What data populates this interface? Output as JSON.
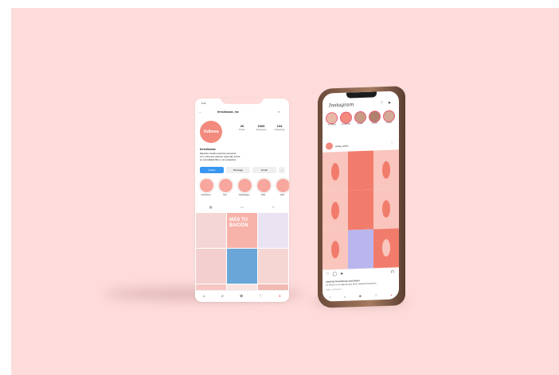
{
  "left_phone": {
    "status_time": "9:41",
    "username": "fervulbosas_mx",
    "avatar_text": "Vulbosa",
    "stats": [
      {
        "n": "26",
        "l": "Posts"
      },
      {
        "n": "1666",
        "l": "Followers"
      },
      {
        "n": "134",
        "l": "Following"
      }
    ],
    "bio_name": "fervulbosas",
    "bio_line1": "Espacio creado para las personas",
    "bio_line2": "con vulva que quieren aprender sobre",
    "bio_line3": "su sexualidad libre y sin prejuicios",
    "buttons": {
      "follow": "Follow",
      "message": "Message",
      "email": "Email",
      "more": "⌄"
    },
    "highlights": [
      "Vulvoloveri",
      "Tips",
      "Vulbojuegos",
      "FAQ",
      "Liker"
    ],
    "tabs": [
      "▦",
      "▭",
      "☺"
    ],
    "grid_colors": [
      "#f4d6d6",
      "#f7b3aa",
      "#e9e3f2",
      "#f4cfcf",
      "#6aa7d8",
      "#f5d6d3",
      "#f6c7c3",
      "#f9e4e2",
      "#f2b8b2"
    ],
    "grid_text": "MÁS TU BACIÓN",
    "nav": [
      "⌂",
      "⌕",
      "⊕",
      "♡",
      "●"
    ]
  },
  "right_phone": {
    "logo": "Instagram",
    "stories": [
      "Tu historia",
      "fervulbosas",
      "usuario",
      "usuario",
      "usuario"
    ],
    "post_user": "vulva_lovers",
    "post_colors": [
      "#f9c5bd",
      "#f27c6c",
      "#f9c5bd",
      "#f9c5bd",
      "#f27c6c",
      "#f9c5bd",
      "#f9c5bd",
      "#b9b6ee",
      "#f27c6c"
    ],
    "actions": [
      "♡",
      "◯",
      "➤"
    ],
    "caption_line1": "Liked by fervulbosas and others",
    "caption_line2": "La Vulva es un órgano que tiene muchas funciones",
    "caption_line3": "Add a comment...",
    "nav": [
      "⌂",
      "⌕",
      "⊕",
      "♡",
      "●"
    ]
  }
}
